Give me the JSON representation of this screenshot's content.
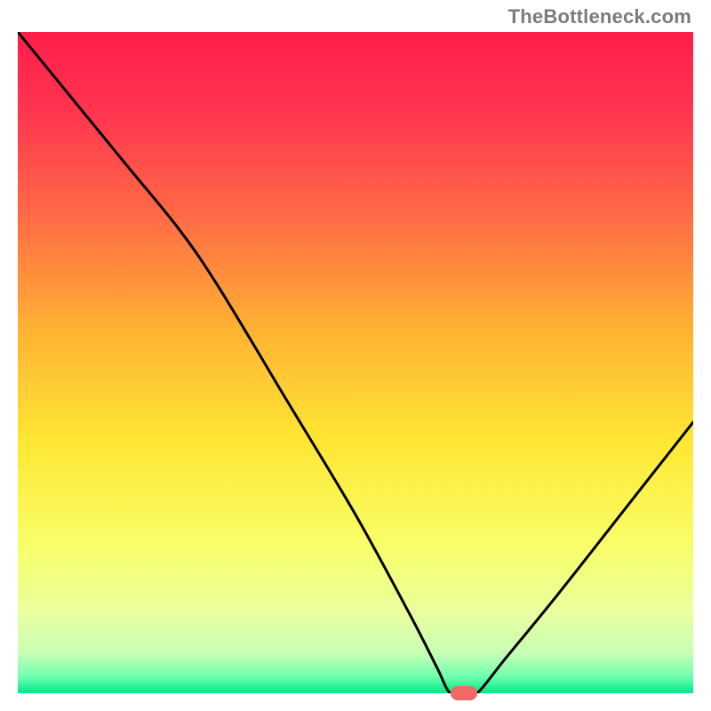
{
  "watermark": "TheBottleneck.com",
  "chart_data": {
    "type": "line",
    "title": "",
    "xlabel": "",
    "ylabel": "",
    "xlim": [
      0,
      100
    ],
    "ylim": [
      0,
      100
    ],
    "grid": false,
    "series": [
      {
        "name": "curve",
        "x": [
          0,
          8,
          16,
          24,
          30,
          40,
          50,
          58,
          62,
          64,
          66,
          68,
          72,
          80,
          90,
          100
        ],
        "y": [
          100,
          90,
          80,
          70,
          61,
          44,
          27,
          12,
          4,
          0,
          0,
          0,
          5,
          15,
          28,
          41
        ]
      }
    ],
    "marker": {
      "x": 66,
      "y": 0,
      "color": "#ef6a62"
    },
    "gradient_stops": [
      {
        "pos": 0.0,
        "color": "#ff1e4a"
      },
      {
        "pos": 0.12,
        "color": "#ff3550"
      },
      {
        "pos": 0.28,
        "color": "#ff6b45"
      },
      {
        "pos": 0.45,
        "color": "#ffb233"
      },
      {
        "pos": 0.62,
        "color": "#ffe733"
      },
      {
        "pos": 0.78,
        "color": "#f8ff6a"
      },
      {
        "pos": 0.88,
        "color": "#eaffa0"
      },
      {
        "pos": 0.94,
        "color": "#c6ffb4"
      },
      {
        "pos": 0.975,
        "color": "#6fffb0"
      },
      {
        "pos": 1.0,
        "color": "#00e888"
      }
    ]
  }
}
